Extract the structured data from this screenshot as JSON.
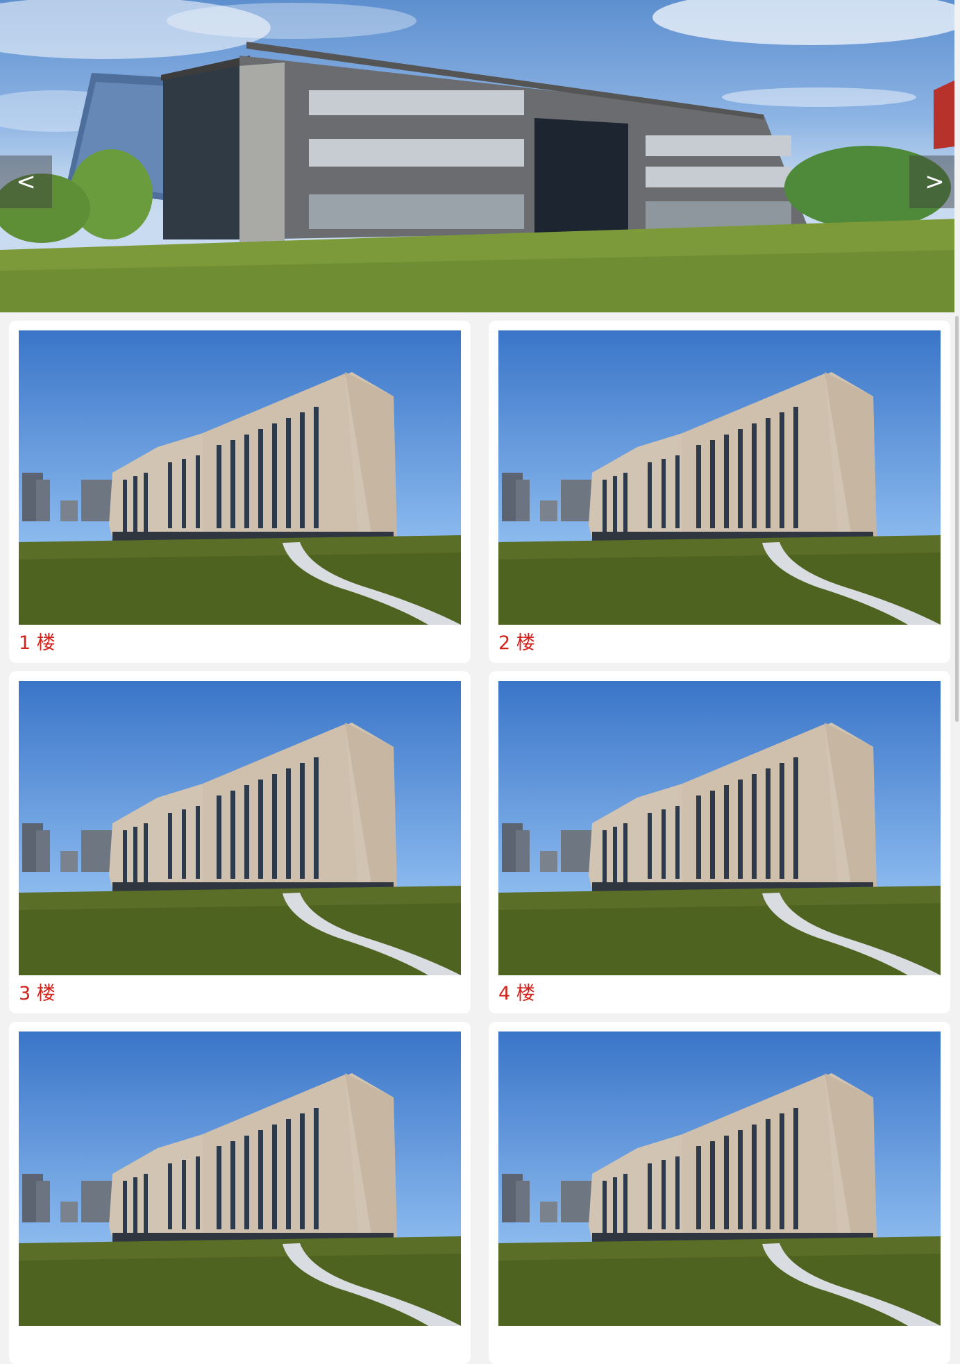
{
  "carousel": {
    "prev_label": "<",
    "next_label": ">"
  },
  "buildings": [
    {
      "label": "1 楼"
    },
    {
      "label": "2 楼"
    },
    {
      "label": "3 楼"
    },
    {
      "label": "4 楼"
    },
    {
      "label": ""
    },
    {
      "label": ""
    }
  ],
  "colors": {
    "caption": "#d3221b",
    "page_background": "#f2f2f2"
  }
}
